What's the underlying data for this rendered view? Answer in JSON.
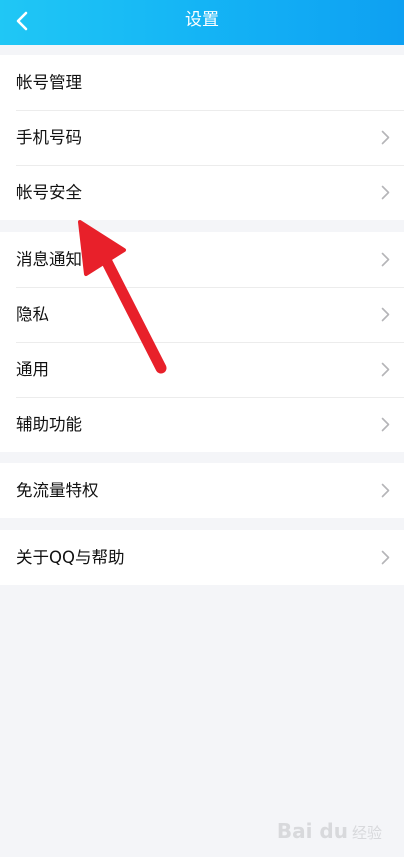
{
  "header": {
    "title": "设置",
    "gradient": [
      "#20c7f5",
      "#0ea0f2"
    ]
  },
  "groups": [
    {
      "items": [
        {
          "label": "帐号管理",
          "chevron": false
        },
        {
          "label": "手机号码",
          "chevron": true
        },
        {
          "label": "帐号安全",
          "chevron": true
        }
      ]
    },
    {
      "items": [
        {
          "label": "消息通知",
          "chevron": true
        },
        {
          "label": "隐私",
          "chevron": true
        },
        {
          "label": "通用",
          "chevron": true
        },
        {
          "label": "辅助功能",
          "chevron": true
        }
      ]
    },
    {
      "items": [
        {
          "label": "免流量特权",
          "chevron": true
        }
      ]
    },
    {
      "items": [
        {
          "label": "关于QQ与帮助",
          "chevron": true
        }
      ]
    }
  ],
  "watermark": {
    "brand": "Bai du",
    "suffix": "经验"
  },
  "colors": {
    "background": "#f4f5f8",
    "arrow": "#e8202a"
  }
}
